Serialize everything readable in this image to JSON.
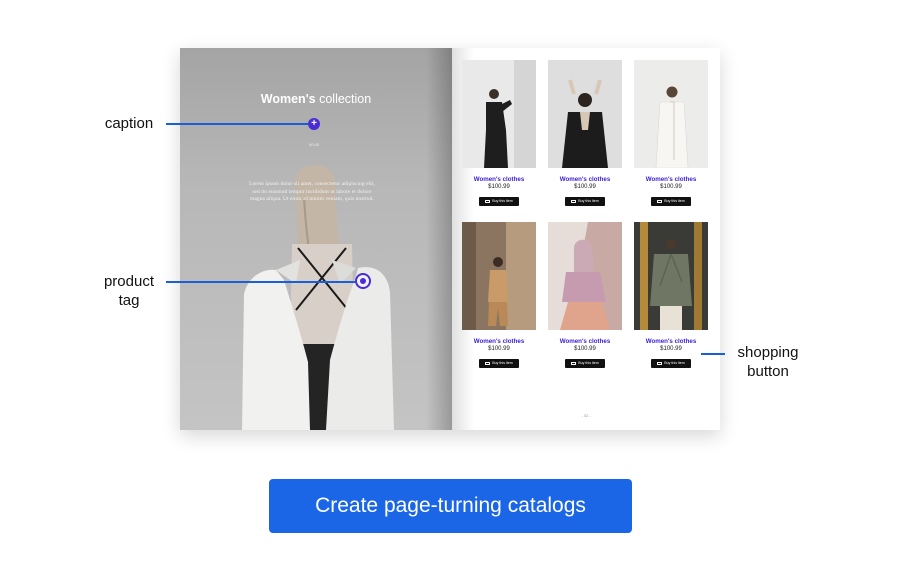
{
  "book": {
    "left_page": {
      "title_bold": "Women's",
      "title_rest": " collection",
      "caption_symbol": "+",
      "small_mark": "00.00",
      "lorem": "Lorem ipsum dolor sit amet, consectetur adipiscing elit, sed do eiusmod tempor incididunt ut labore et dolore magna aliqua. Ut enim ad minim veniam, quis nostrud."
    },
    "right_page": {
      "products": [
        {
          "name": "Women's clothes",
          "price": "$100.99",
          "button": "Buy this item"
        },
        {
          "name": "Women's clothes",
          "price": "$100.99",
          "button": "Buy this item"
        },
        {
          "name": "Women's clothes",
          "price": "$100.99",
          "button": "Buy this item"
        },
        {
          "name": "Women's clothes",
          "price": "$100.99",
          "button": "Buy this item"
        },
        {
          "name": "Women's clothes",
          "price": "$100.99",
          "button": "Buy this item"
        },
        {
          "name": "Women's clothes",
          "price": "$100.99",
          "button": "Buy this item"
        }
      ],
      "page_number": "- 02 -"
    }
  },
  "callouts": {
    "caption": "caption",
    "product_tag_line1": "product",
    "product_tag_line2": "tag",
    "shopping_button_line1": "shopping",
    "shopping_button_line2": "button"
  },
  "cta": {
    "label": "Create page-turning catalogs"
  },
  "colors": {
    "accent_purple": "#4a2bd6",
    "callout_blue": "#1a5fd8",
    "cta_blue": "#1a66e6"
  },
  "icons": [
    "plus-icon",
    "target-icon",
    "cart-icon"
  ]
}
